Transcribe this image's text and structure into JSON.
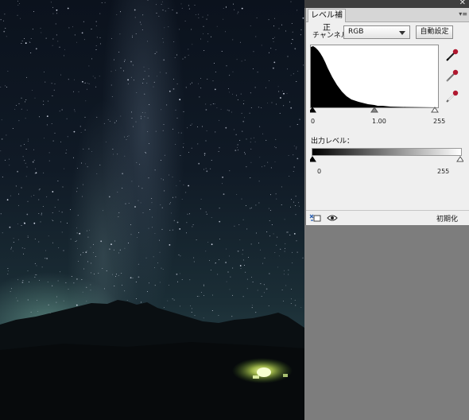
{
  "panel": {
    "tab_label": "レベル補正",
    "menu_icon": "panel-menu-icon",
    "close_icon": "close-icon",
    "channel_label": "チャンネル：",
    "channel_value": "RGB",
    "auto_button": "自動設定",
    "eyedroppers": [
      "black-point-eyedropper-icon",
      "gray-point-eyedropper-icon",
      "white-point-eyedropper-icon"
    ],
    "input_levels": {
      "black": "0",
      "gamma": "1.00",
      "white": "255"
    },
    "output_label": "出力レベル：",
    "output_levels": {
      "black": "0",
      "white": "255"
    },
    "footer": {
      "clip_icon": "clip-to-layer-icon",
      "eye_icon": "visibility-eye-icon",
      "reset_label": "初期化"
    }
  },
  "photo": {
    "subject": "night-sky-milky-way-photo"
  }
}
